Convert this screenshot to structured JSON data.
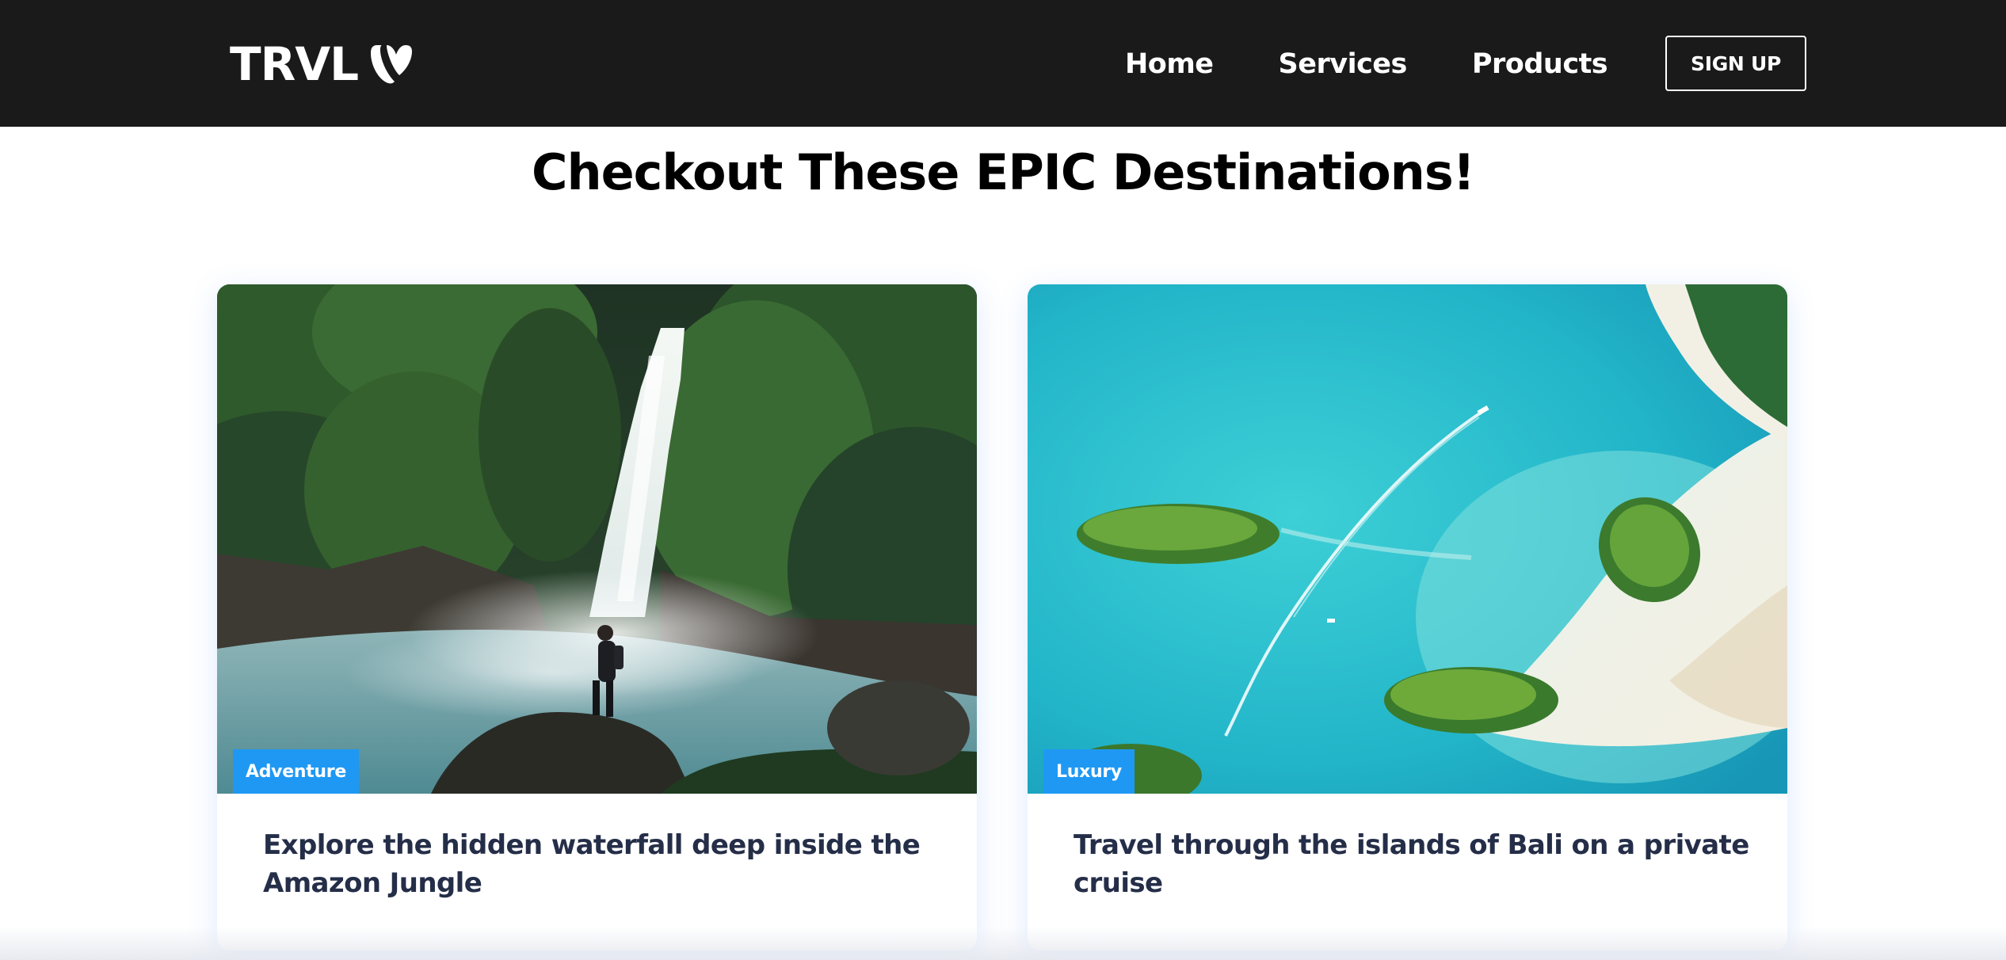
{
  "navbar": {
    "logo_text": "TRVL",
    "logo_icon": "typo3-logo-icon",
    "links": [
      {
        "label": "Home"
      },
      {
        "label": "Services"
      },
      {
        "label": "Products"
      }
    ],
    "signup_label": "SIGN UP"
  },
  "main": {
    "heading": "Checkout These EPIC Destinations!",
    "cards": [
      {
        "badge": "Adventure",
        "title": "Explore the hidden waterfall deep inside the Amazon Jungle",
        "image": "waterfall-photo"
      },
      {
        "badge": "Luxury",
        "title": "Travel through the islands of Bali on a private cruise",
        "image": "bali-islands-aerial-photo"
      }
    ]
  },
  "colors": {
    "navbar_bg": "#1b1a1a",
    "badge_bg": "#1f98f4",
    "card_title": "#252e48",
    "heading": "#000000"
  }
}
